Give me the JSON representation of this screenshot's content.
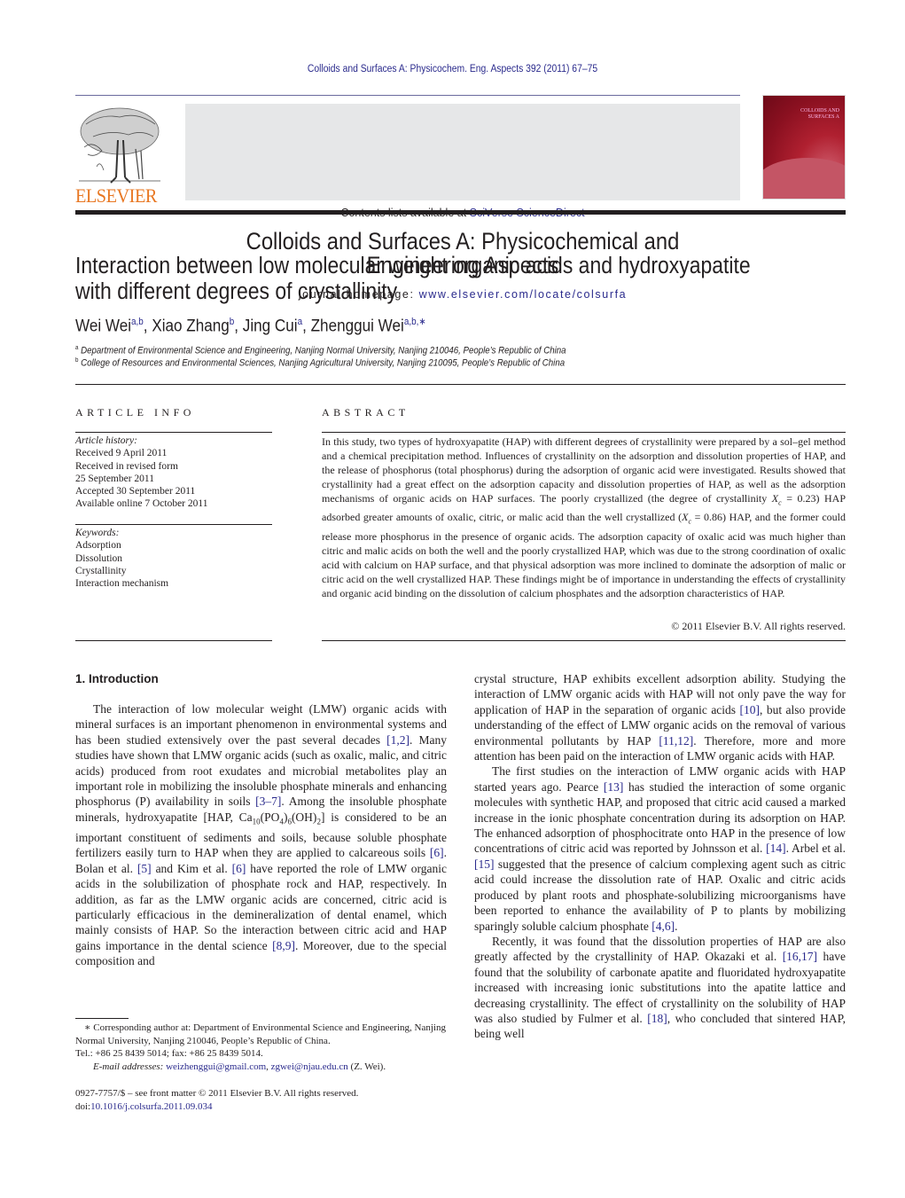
{
  "running_header": "Colloids and Surfaces A: Physicochem. Eng. Aspects 392 (2011) 67–75",
  "masthead": {
    "publisher_logo_text": "ELSEVIER",
    "contents_prefix": "Contents lists available at ",
    "contents_link": "SciVerse ScienceDirect",
    "journal_title_line1": "Colloids and Surfaces A: Physicochemical and",
    "journal_title_line2": "Engineering Aspects",
    "homepage_prefix": "journal homepage: ",
    "homepage_link": "www.elsevier.com/locate/colsurfa",
    "cover_title_line1": "COLLOIDS AND",
    "cover_title_line2": "SURFACES A",
    "colors": {
      "logo_orange": "#e87722",
      "link_blue": "#2a2a8c",
      "cover_red": "#8a1020",
      "masthead_gray": "#e6e7e8"
    }
  },
  "article": {
    "title_line1": "Interaction between low molecular weight organic acids and hydroxyapatite",
    "title_line2": "with different degrees of crystallinity",
    "authors": [
      {
        "name": "Wei Wei",
        "sup": "a,b"
      },
      {
        "name": "Xiao Zhang",
        "sup": "b"
      },
      {
        "name": "Jing Cui",
        "sup": "a"
      },
      {
        "name": "Zhenggui Wei",
        "sup": "a,b,∗"
      }
    ],
    "affiliations": [
      {
        "mark": "a",
        "text": "Department of Environmental Science and Engineering, Nanjing Normal University, Nanjing 210046, People’s Republic of China"
      },
      {
        "mark": "b",
        "text": "College of Resources and Environmental Sciences, Nanjing Agricultural University, Nanjing 210095, People’s Republic of China"
      }
    ]
  },
  "article_info": {
    "heading": "ARTICLE INFO",
    "history_label": "Article history:",
    "history": [
      "Received 9 April 2011",
      "Received in revised form",
      "25 September 2011",
      "Accepted 30 September 2011",
      "Available online 7 October 2011"
    ],
    "keywords_label": "Keywords:",
    "keywords": [
      "Adsorption",
      "Dissolution",
      "Crystallinity",
      "Interaction mechanism"
    ]
  },
  "abstract": {
    "heading": "ABSTRACT",
    "text_part1": "In this study, two types of hydroxyapatite (HAP) with different degrees of crystallinity were prepared by a sol–gel method and a chemical precipitation method. Influences of crystallinity on the adsorption and dissolution properties of HAP, and the release of phosphorus (total phosphorus) during the adsorption of organic acid were investigated. Results showed that crystallinity had a great effect on the adsorption capacity and dissolution properties of HAP, as well as the adsorption mechanisms of organic acids on HAP surfaces. The poorly crystallized (the degree of crystallinity ",
    "xc_symbol": "X",
    "xc_sub": "c",
    "xc_value1": " = 0.23) HAP adsorbed greater amounts of oxalic, citric, or malic acid than the well crystallized (",
    "xc_value2": " = 0.86) HAP, and the former could release more phosphorus in the presence of organic acids. The adsorption capacity of oxalic acid was much higher than citric and malic acids on both the well and the poorly crystallized HAP, which was due to the strong coordination of oxalic acid with calcium on HAP surface, and that physical adsorption was more inclined to dominate the adsorption of malic or citric acid on the well crystallized HAP. These findings might be of importance in understanding the effects of crystallinity and organic acid binding on the dissolution of calcium phosphates and the adsorption characteristics of HAP.",
    "copyright": "© 2011 Elsevier B.V. All rights reserved."
  },
  "body": {
    "section1_heading": "1.  Introduction",
    "left_p1_a": "The interaction of low molecular weight (LMW) organic acids with mineral surfaces is an important phenomenon in environmental systems and has been studied extensively over the past several decades ",
    "ref_1_2": "[1,2]",
    "left_p1_b": ". Many studies have shown that LMW organic acids (such as oxalic, malic, and citric acids) produced from root exudates and microbial metabolites play an important role in mobilizing the insoluble phosphate minerals and enhancing phosphorus (P) availability in soils ",
    "ref_3_7": "[3–7]",
    "left_p1_c": ". Among the insoluble phosphate minerals, hydroxyapatite [HAP, Ca",
    "formula_sub1": "10",
    "formula_mid1": "(PO",
    "formula_sub2": "4",
    "formula_mid2": ")",
    "formula_sub3": "6",
    "formula_mid3": "(OH)",
    "formula_sub4": "2",
    "left_p1_d": "] is considered to be an important constituent of sediments and soils, because soluble phosphate fertilizers easily turn to HAP when they are applied to calcareous soils ",
    "ref_6a": "[6]",
    "left_p1_e": ". Bolan et al. ",
    "ref_5": "[5]",
    "left_p1_f": " and Kim et al. ",
    "ref_6b": "[6]",
    "left_p1_g": " have reported the role of LMW organic acids in the solubilization of phosphate rock and HAP, respectively. In addition, as far as the LMW organic acids are concerned, citric acid is particularly efficacious in the demineralization of dental enamel, which mainly consists of HAP. So the interaction between citric acid and HAP gains importance in the dental science ",
    "ref_8_9": "[8,9]",
    "left_p1_h": ". Moreover, due to the special composition and",
    "right_p1_a": "crystal structure, HAP exhibits excellent adsorption ability. Studying the interaction of LMW organic acids with HAP will not only pave the way for application of HAP in the separation of organic acids ",
    "ref_10": "[10]",
    "right_p1_b": ", but also provide understanding of the effect of LMW organic acids on the removal of various environmental pollutants by HAP ",
    "ref_11_12": "[11,12]",
    "right_p1_c": ". Therefore, more and more attention has been paid on the interaction of LMW organic acids with HAP.",
    "right_p2_a": "The first studies on the interaction of LMW organic acids with HAP started years ago. Pearce ",
    "ref_13": "[13]",
    "right_p2_b": " has studied the interaction of some organic molecules with synthetic HAP, and proposed that citric acid caused a marked increase in the ionic phosphate concentration during its adsorption on HAP. The enhanced adsorption of phosphocitrate onto HAP in the presence of low concentrations of citric acid was reported by Johnsson et al. ",
    "ref_14": "[14]",
    "right_p2_c": ". Arbel et al. ",
    "ref_15": "[15]",
    "right_p2_d": " suggested that the presence of calcium complexing agent such as citric acid could increase the dissolution rate of HAP. Oxalic and citric acids produced by plant roots and phosphate-solubilizing microorganisms have been reported to enhance the availability of P to plants by mobilizing sparingly soluble calcium phosphate ",
    "ref_4_6": "[4,6]",
    "right_p2_e": ".",
    "right_p3_a": "Recently, it was found that the dissolution properties of HAP are also greatly affected by the crystallinity of HAP. Okazaki et al. ",
    "ref_16_17": "[16,17]",
    "right_p3_b": " have found that the solubility of carbonate apatite and fluoridated hydroxyapatite increased with increasing ionic substitutions into the apatite lattice and decreasing crystallinity. The effect of crystallinity on the solubility of HAP was also studied by Fulmer et al. ",
    "ref_18": "[18]",
    "right_p3_c": ", who concluded that sintered HAP, being well"
  },
  "footnote": {
    "corresponding": "∗ Corresponding author at: Department of Environmental Science and Engineering, Nanjing Normal University, Nanjing 210046, People’s Republic of China.",
    "tel": "Tel.: +86 25 8439 5014; fax: +86 25 8439 5014.",
    "email_label": "E-mail addresses:",
    "email1": "weizhenggui@gmail.com",
    "email2": "zgwei@njau.edu.cn",
    "email_suffix": " (Z. Wei).",
    "issn": "0927-7757/$ – see front matter © 2011 Elsevier B.V. All rights reserved.",
    "doi_prefix": "doi:",
    "doi": "10.1016/j.colsurfa.2011.09.034"
  }
}
